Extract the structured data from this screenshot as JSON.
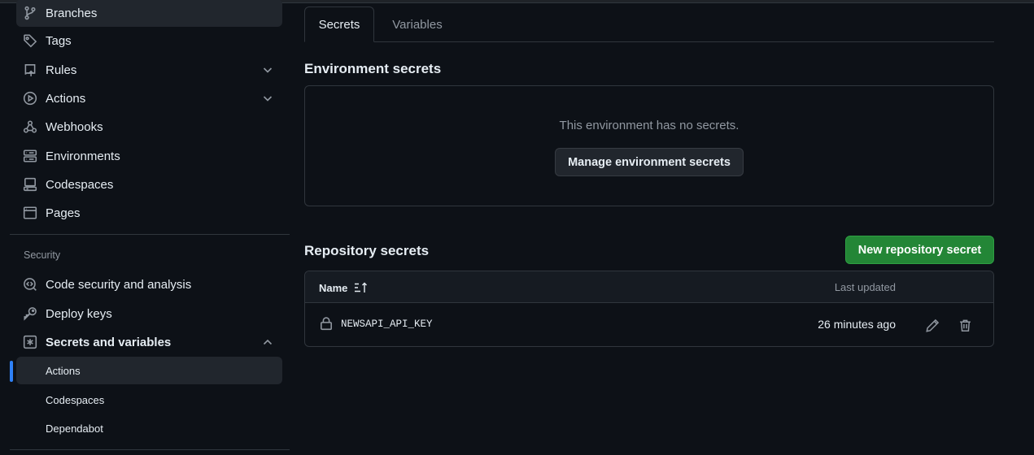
{
  "sidebar": {
    "items": [
      {
        "label": "Branches",
        "icon": "git-branch-icon"
      },
      {
        "label": "Tags",
        "icon": "tag-icon"
      },
      {
        "label": "Rules",
        "icon": "repo-push-icon"
      },
      {
        "label": "Actions",
        "icon": "play-icon"
      },
      {
        "label": "Webhooks",
        "icon": "webhook-icon"
      },
      {
        "label": "Environments",
        "icon": "server-icon"
      },
      {
        "label": "Codespaces",
        "icon": "codespaces-icon"
      },
      {
        "label": "Pages",
        "icon": "browser-icon"
      }
    ],
    "security_section": {
      "label": "Security",
      "items": [
        {
          "label": "Code security and analysis",
          "icon": "codescan-icon"
        },
        {
          "label": "Deploy keys",
          "icon": "key-icon"
        },
        {
          "label": "Secrets and variables",
          "icon": "asterisk-icon"
        }
      ],
      "sub_items": [
        {
          "label": "Actions"
        },
        {
          "label": "Codespaces"
        },
        {
          "label": "Dependabot"
        }
      ]
    }
  },
  "tabs": [
    {
      "label": "Secrets",
      "active": true
    },
    {
      "label": "Variables",
      "active": false
    }
  ],
  "environment_secrets": {
    "heading": "Environment secrets",
    "empty_text": "This environment has no secrets.",
    "manage_button": "Manage environment secrets"
  },
  "repository_secrets": {
    "heading": "Repository secrets",
    "new_button": "New repository secret",
    "columns": {
      "name": "Name",
      "updated": "Last updated"
    },
    "rows": [
      {
        "name": "NEWSAPI_API_KEY",
        "updated": "26 minutes ago"
      }
    ]
  },
  "colors": {
    "background": "#0d1117",
    "border": "#30363d",
    "accent_blue": "#2f81f7",
    "primary_green": "#238636"
  }
}
